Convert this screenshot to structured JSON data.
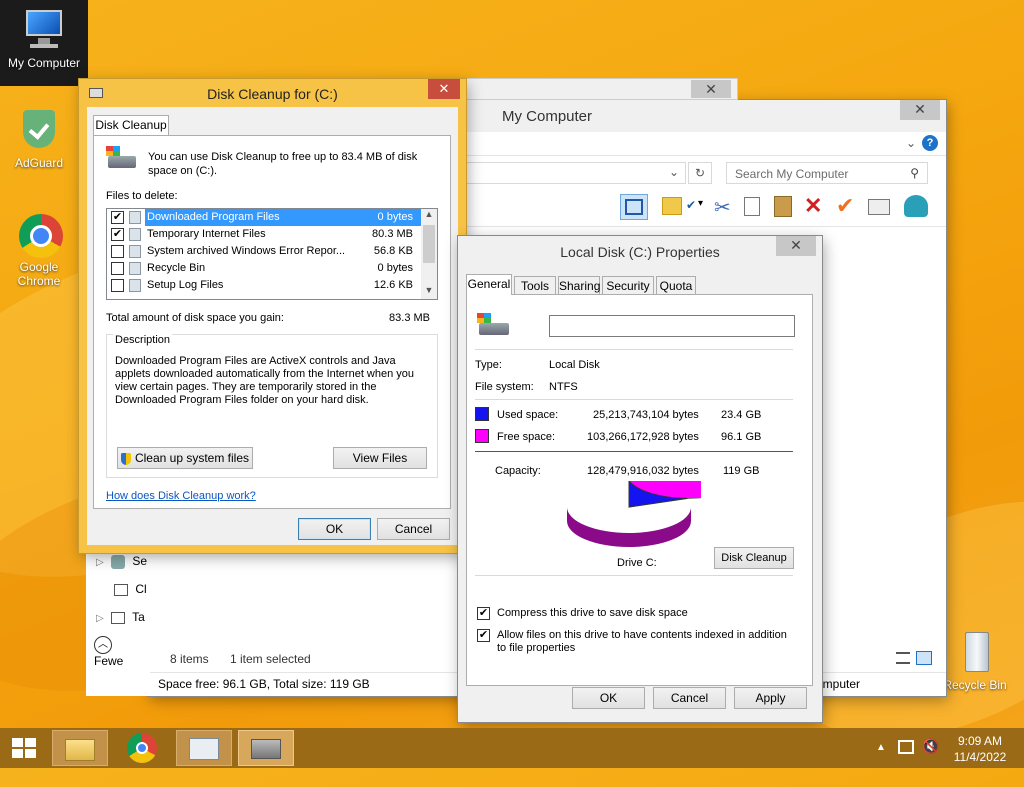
{
  "desktop": {
    "icons": [
      {
        "label": "My Computer"
      },
      {
        "label": "AdGuard"
      },
      {
        "label": "Google Chrome"
      },
      {
        "label": "Recycle Bin"
      }
    ]
  },
  "explorer": {
    "title": "My Computer",
    "search_placeholder": "Search My Computer",
    "status_items": "8 items",
    "status_selected": "1 item selected",
    "space_info": "Space free: 96.1 GB, Total size: 119 GB",
    "nav_items": [
      "Se",
      "Cl",
      "Ta"
    ],
    "fewer_details": "Fewe",
    "computer_partial": "omputer"
  },
  "cleanup": {
    "title": "Disk Cleanup for  (C:)",
    "tab": "Disk Cleanup",
    "intro": "You can use Disk Cleanup to free up to 83.4 MB of disk space on  (C:).",
    "files_label": "Files to delete:",
    "files": [
      {
        "name": "Downloaded Program Files",
        "size": "0 bytes",
        "checked": true,
        "selected": true
      },
      {
        "name": "Temporary Internet Files",
        "size": "80.3 MB",
        "checked": true,
        "selected": false
      },
      {
        "name": "System archived Windows Error Repor...",
        "size": "56.8 KB",
        "checked": false,
        "selected": false
      },
      {
        "name": "Recycle Bin",
        "size": "0 bytes",
        "checked": false,
        "selected": false
      },
      {
        "name": "Setup Log Files",
        "size": "12.6 KB",
        "checked": false,
        "selected": false
      }
    ],
    "total_label": "Total amount of disk space you gain:",
    "total_value": "83.3 MB",
    "description_label": "Description",
    "description": "Downloaded Program Files are ActiveX controls and Java applets downloaded automatically from the Internet when you view certain pages. They are temporarily stored in the Downloaded Program Files folder on your hard disk.",
    "cleanup_system_btn": "Clean up system files",
    "view_files_btn": "View Files",
    "help_link": "How does Disk Cleanup work?",
    "ok": "OK",
    "cancel": "Cancel"
  },
  "properties": {
    "title": "Local Disk (C:) Properties",
    "tabs": [
      "General",
      "Tools",
      "Sharing",
      "Security",
      "Quota"
    ],
    "label_value": "",
    "type_label": "Type:",
    "type_value": "Local Disk",
    "fs_label": "File system:",
    "fs_value": "NTFS",
    "used_label": "Used space:",
    "used_bytes": "25,213,743,104 bytes",
    "used_gb": "23.4 GB",
    "free_label": "Free space:",
    "free_bytes": "103,266,172,928 bytes",
    "free_gb": "96.1 GB",
    "capacity_label": "Capacity:",
    "capacity_bytes": "128,479,916,032 bytes",
    "capacity_gb": "119 GB",
    "drive_label": "Drive C:",
    "disk_cleanup_btn": "Disk Cleanup",
    "compress_label": "Compress this drive to save disk space",
    "index_label": "Allow files on this drive to have contents indexed in addition to file properties",
    "ok": "OK",
    "cancel": "Cancel",
    "apply": "Apply",
    "used_color": "#1414f0",
    "free_color": "#ff00ff",
    "used_fraction": 0.196
  },
  "taskbar": {
    "time": "9:09 AM",
    "date": "11/4/2022"
  }
}
